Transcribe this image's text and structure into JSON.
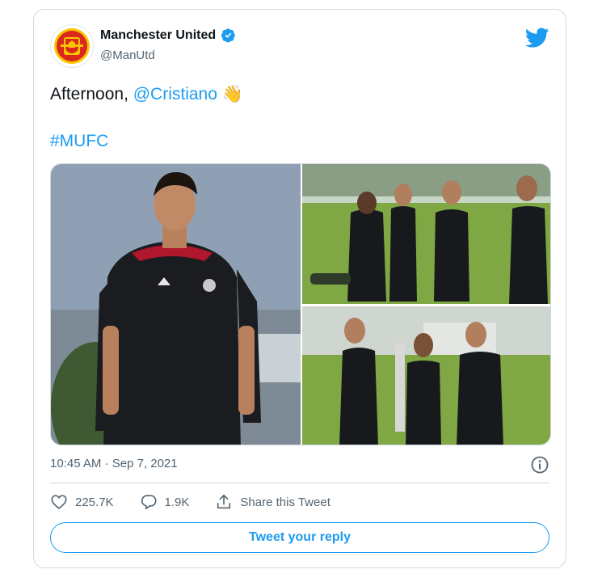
{
  "account": {
    "name": "Manchester United",
    "handle": "@ManUtd",
    "verified": true,
    "brand_color": "#da291c"
  },
  "tweet": {
    "text_prefix": "Afternoon, ",
    "mention": "@Cristiano",
    "emoji": "👋",
    "hashtag": "#MUFC",
    "timestamp": "10:45 AM · Sep 7, 2021"
  },
  "media": {
    "count": 3
  },
  "actions": {
    "likes": "225.7K",
    "replies": "1.9K",
    "share_label": "Share this Tweet"
  },
  "reply_button": {
    "label": "Tweet your reply"
  },
  "colors": {
    "accent": "#1d9bf0",
    "secondary_text": "#536471",
    "border": "#cfd9de"
  },
  "icons": [
    "twitter-bird-icon",
    "verified-badge-icon",
    "info-icon",
    "heart-icon",
    "reply-icon",
    "share-icon"
  ]
}
